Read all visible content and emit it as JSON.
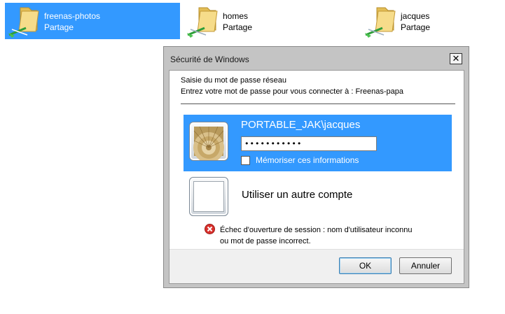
{
  "shares": [
    {
      "name": "freenas-photos",
      "type": "Partage",
      "selected": true
    },
    {
      "name": "homes",
      "type": "Partage",
      "selected": false
    },
    {
      "name": "jacques",
      "type": "Partage",
      "selected": false
    }
  ],
  "dialog": {
    "title": "Sécurité de Windows",
    "close_symbol": "✕",
    "subtitle": "Saisie du mot de passe réseau",
    "instruction": "Entrez votre mot de passe pour vous connecter à : Freenas-papa",
    "selected_account": {
      "username": "PORTABLE_JAK\\jacques",
      "password_mask": "•••••••••••",
      "remember_label": "Mémoriser ces informations",
      "remember_checked": false
    },
    "other_account_label": "Utiliser un autre compte",
    "error_lines": [
      "Échec d'ouverture de session : nom d'utilisateur inconnu",
      "ou mot de passe incorrect."
    ],
    "ok_label": "OK",
    "cancel_label": "Annuler"
  },
  "colors": {
    "selection": "#3399ff",
    "error": "#d9302c",
    "folder": "#f1d27a"
  },
  "icons": [
    "network-folder-icon",
    "user-avatar-icon",
    "error-icon",
    "close-icon",
    "checkbox"
  ]
}
